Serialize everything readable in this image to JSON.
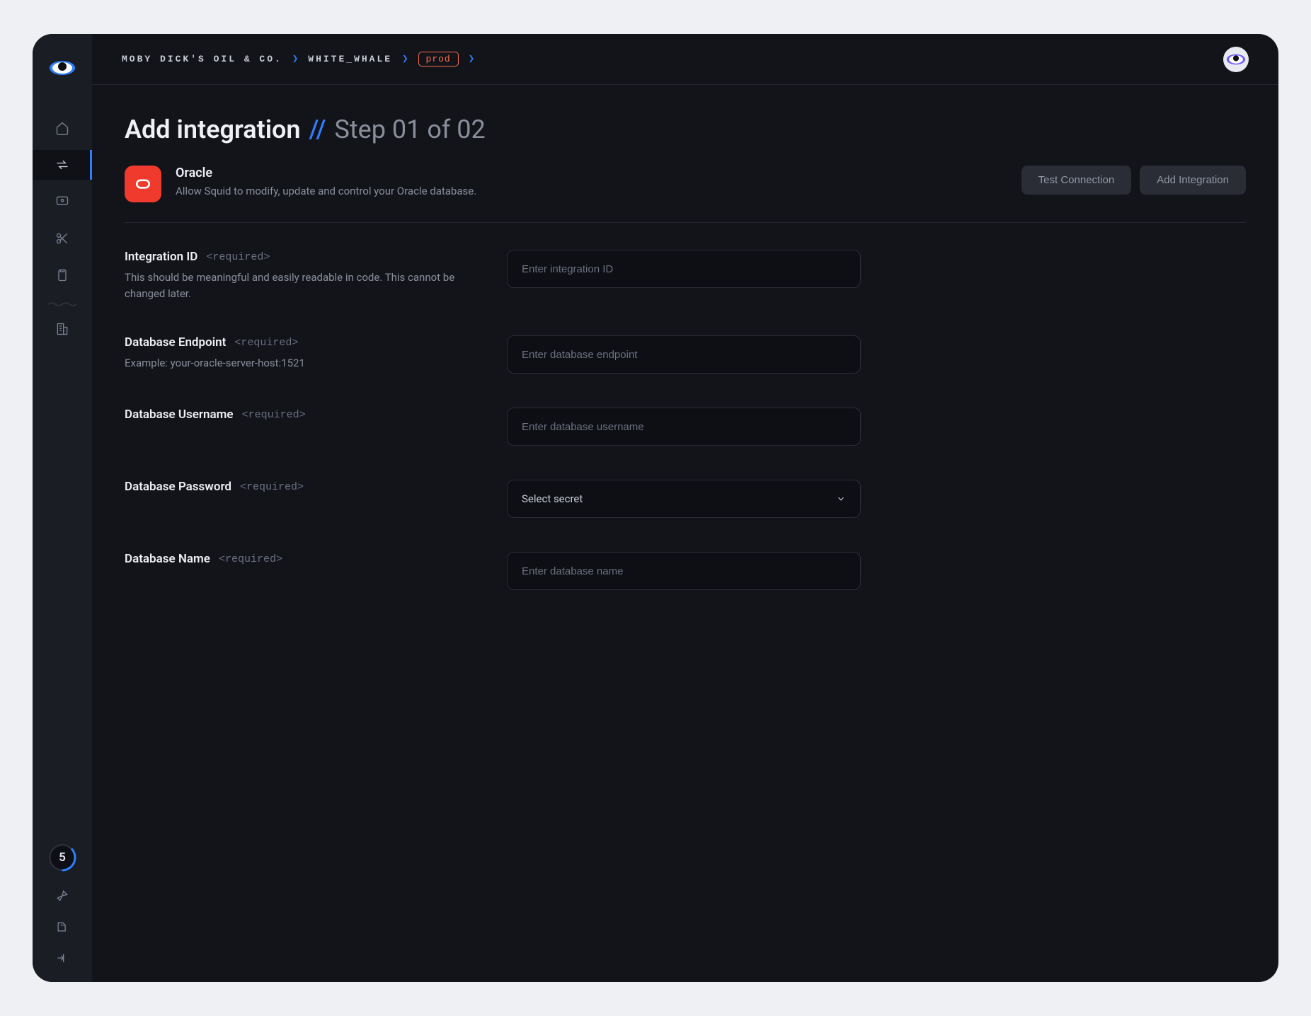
{
  "breadcrumbs": {
    "org": "MOBY DICK'S OIL & CO.",
    "project": "WHITE_WHALE",
    "env": "prod"
  },
  "page": {
    "title": "Add integration",
    "step": "Step 01 of 02"
  },
  "integration": {
    "name": "Oracle",
    "description": "Allow Squid to modify, update and control your Oracle database."
  },
  "actions": {
    "test": "Test Connection",
    "add": "Add Integration"
  },
  "sidebar": {
    "counter": "5"
  },
  "form": {
    "required_tag": "<required>",
    "integration_id": {
      "label": "Integration ID",
      "hint": "This should be meaningful and easily readable in code. This cannot be changed later.",
      "placeholder": "Enter integration ID"
    },
    "endpoint": {
      "label": "Database Endpoint",
      "hint": "Example: your-oracle-server-host:1521",
      "placeholder": "Enter database endpoint"
    },
    "username": {
      "label": "Database Username",
      "placeholder": "Enter database username"
    },
    "password": {
      "label": "Database Password",
      "placeholder": "Select secret"
    },
    "dbname": {
      "label": "Database Name",
      "placeholder": "Enter database name"
    }
  }
}
